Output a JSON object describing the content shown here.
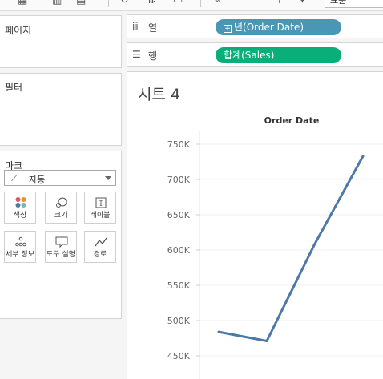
{
  "toolbar": {
    "icons": [
      "add-sheet-icon",
      "duplicate-icon",
      "clear-sheet-icon",
      "undo-icon",
      "sort-icon",
      "highlight-icon",
      "pencil-icon",
      "label-icon",
      "pin-icon"
    ],
    "fit_value": "표준"
  },
  "left": {
    "pages_title": "페이지",
    "filters_title": "필터",
    "marks_title": "마크",
    "mark_type": "자동",
    "cards": [
      {
        "label": "색상",
        "icon": "color-icon"
      },
      {
        "label": "크기",
        "icon": "size-icon"
      },
      {
        "label": "레이블",
        "icon": "label-icon"
      },
      {
        "label": "세부 정보",
        "icon": "detail-icon"
      },
      {
        "label": "도구 설명",
        "icon": "tooltip-icon"
      },
      {
        "label": "경로",
        "icon": "path-icon"
      }
    ]
  },
  "shelves": {
    "columns_label": "열",
    "columns_pill": "년(Order Date)",
    "rows_label": "행",
    "rows_pill": "합계(Sales)"
  },
  "sheet": {
    "title": "시트 4",
    "header": "Order Date"
  },
  "colors": {
    "line": "#4e79a7",
    "pill_blue": "#4a96b6",
    "pill_green": "#0aae79"
  },
  "chart_data": {
    "type": "line",
    "title": "",
    "xlabel": "Order Date",
    "ylabel": "",
    "ylim": [
      430000,
      765000
    ],
    "yticks": [
      450000,
      500000,
      550000,
      600000,
      650000,
      700000,
      750000
    ],
    "ytick_labels": [
      "450K",
      "500K",
      "550K",
      "600K",
      "650K",
      "700K",
      "750K"
    ],
    "values": [
      484000,
      471000,
      609000,
      733000
    ],
    "grid": true
  }
}
